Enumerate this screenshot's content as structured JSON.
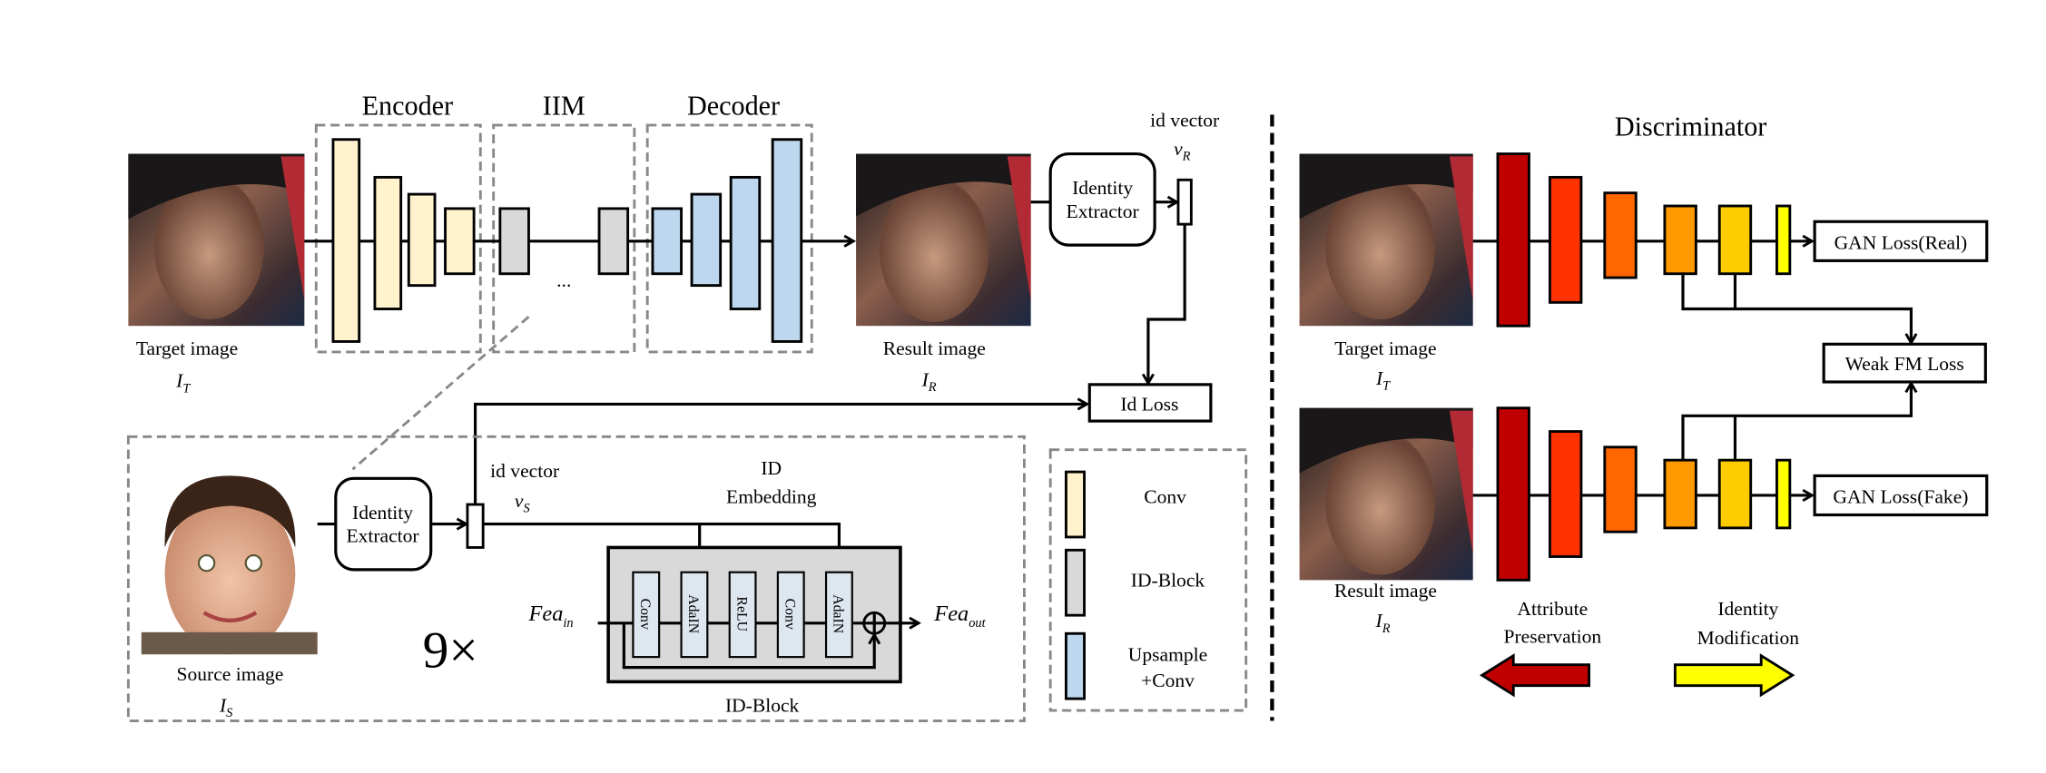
{
  "generator": {
    "encoder_title": "Encoder",
    "iim_title": "IIM",
    "decoder_title": "Decoder",
    "ellipsis": "...",
    "target_label": "Target image",
    "target_symbol": "I",
    "target_sub": "T",
    "result_label": "Result image",
    "result_symbol": "I",
    "result_sub": "R",
    "extractor_line1": "Identity",
    "extractor_line2": "Extractor",
    "id_vector_label": "id vector",
    "v_r_symbol": "v",
    "v_r_sub": "R",
    "id_loss": "Id Loss"
  },
  "id_block_detail": {
    "source_label": "Source image",
    "source_symbol": "I",
    "source_sub": "S",
    "extractor_line1": "Identity",
    "extractor_line2": "Extractor",
    "id_vector_label": "id vector",
    "v_s_symbol": "v",
    "v_s_sub": "S",
    "embedding_line1": "ID",
    "embedding_line2": "Embedding",
    "repeat": "9×",
    "fea_in": "Fea",
    "fea_in_sub": "in",
    "fea_out": "Fea",
    "fea_out_sub": "out",
    "layers": [
      "Conv",
      "AdaIN",
      "ReLU",
      "Conv",
      "AdaIN"
    ],
    "block_title": "ID-Block"
  },
  "legend": {
    "items": [
      {
        "label": "Conv",
        "color": "#FFF2CC"
      },
      {
        "label": "ID-Block",
        "color": "#D9D9D9"
      },
      {
        "label_line1": "Upsample",
        "label_line2": "+Conv",
        "color": "#BDD7EE"
      }
    ]
  },
  "discriminator": {
    "title": "Discriminator",
    "target_label": "Target image",
    "target_symbol": "I",
    "target_sub": "T",
    "result_label": "Result image",
    "result_symbol": "I",
    "result_sub": "R",
    "gan_real": "GAN Loss(Real)",
    "gan_fake": "GAN Loss(Fake)",
    "weak_fm": "Weak FM Loss",
    "layer_colors": [
      "#C00000",
      "#FF3300",
      "#FF6600",
      "#FF9900",
      "#FFCC00",
      "#FFFF00"
    ],
    "attr_line1": "Attribute",
    "attr_line2": "Preservation",
    "ident_line1": "Identity",
    "ident_line2": "Modification",
    "attr_arrow_color": "#C00000",
    "ident_arrow_color": "#FFFF00"
  }
}
